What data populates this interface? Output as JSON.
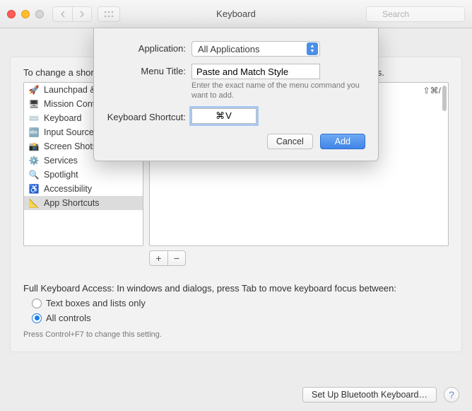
{
  "titlebar": {
    "title": "Keyboard",
    "search_placeholder": "Search"
  },
  "panel": {
    "intro": "To change a shortcut, select it, double-click the key combination, then type the new keys.",
    "sidebar": [
      {
        "icon": "🚀",
        "label": "Launchpad & Dock",
        "selected": false
      },
      {
        "icon": "🖥",
        "label": "Mission Control",
        "selected": false
      },
      {
        "icon": "⌨️",
        "label": "Keyboard",
        "selected": false
      },
      {
        "icon": "🔤",
        "label": "Input Sources",
        "selected": false
      },
      {
        "icon": "📸",
        "label": "Screen Shots",
        "selected": false
      },
      {
        "icon": "⚙️",
        "label": "Services",
        "selected": false
      },
      {
        "icon": "🔍",
        "label": "Spotlight",
        "selected": false
      },
      {
        "icon": "♿",
        "label": "Accessibility",
        "selected": false
      },
      {
        "icon": "📐",
        "label": "App Shortcuts",
        "selected": true
      }
    ],
    "right_hint": "⇧⌘/",
    "add_label": "+",
    "remove_label": "−",
    "fka_text": "Full Keyboard Access: In windows and dialogs, press Tab to move keyboard focus between:",
    "radio1": "Text boxes and lists only",
    "radio2": "All controls",
    "radio_selected": 2,
    "hint": "Press Control+F7 to change this setting.",
    "setup_bt": "Set Up Bluetooth Keyboard…"
  },
  "sheet": {
    "labels": {
      "application": "Application:",
      "menu_title": "Menu Title:",
      "shortcut": "Keyboard Shortcut:"
    },
    "application_value": "All Applications",
    "menu_title_value": "Paste and Match Style",
    "menu_title_helper": "Enter the exact name of the menu command you want to add.",
    "shortcut_value": "⌘V",
    "cancel": "Cancel",
    "add": "Add"
  }
}
